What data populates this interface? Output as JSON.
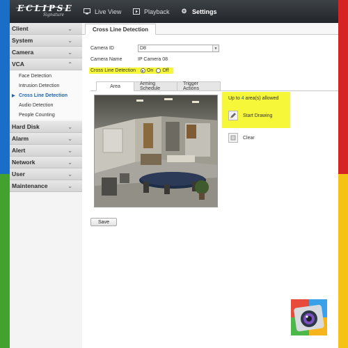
{
  "brand": {
    "logo": "ECLIPSE",
    "logo_sub": "Signature"
  },
  "nav": {
    "live_view": "Live View",
    "playback": "Playback",
    "settings": "Settings"
  },
  "sidebar": {
    "groups": [
      {
        "label": "Client"
      },
      {
        "label": "System"
      },
      {
        "label": "Camera"
      },
      {
        "label": "VCA",
        "items": [
          "Face Detection",
          "Intrusion Detection",
          "Cross Line Detection",
          "Audio Detection",
          "People Counting"
        ],
        "active": "Cross Line Detection"
      },
      {
        "label": "Hard Disk"
      },
      {
        "label": "Alarm"
      },
      {
        "label": "Alert"
      },
      {
        "label": "Network"
      },
      {
        "label": "User"
      },
      {
        "label": "Maintenance"
      }
    ]
  },
  "page": {
    "tab": "Cross Line Detection",
    "camera_id_label": "Camera ID",
    "camera_id_value": "D8",
    "camera_name_label": "Camera Name",
    "camera_name_value": "IP Camera 08",
    "cld_label": "Cross Line Detection",
    "on_label": "On",
    "off_label": "Off",
    "on_selected": true,
    "subtabs": [
      "Area",
      "Arming Schedule",
      "Trigger Actions"
    ],
    "active_subtab": "Area",
    "allowed_prefix": "Up to",
    "allowed_count": "4",
    "allowed_suffix": "area(s) allowed",
    "start_drawing": "Start Drawing",
    "clear": "Clear",
    "save": "Save"
  },
  "colors": {
    "frame_blue": "#1b6ec8",
    "frame_green": "#43a12e",
    "frame_red": "#d62424",
    "frame_yellow": "#f4c315",
    "highlight": "#f7f73a",
    "accent": "#1c63b5"
  }
}
